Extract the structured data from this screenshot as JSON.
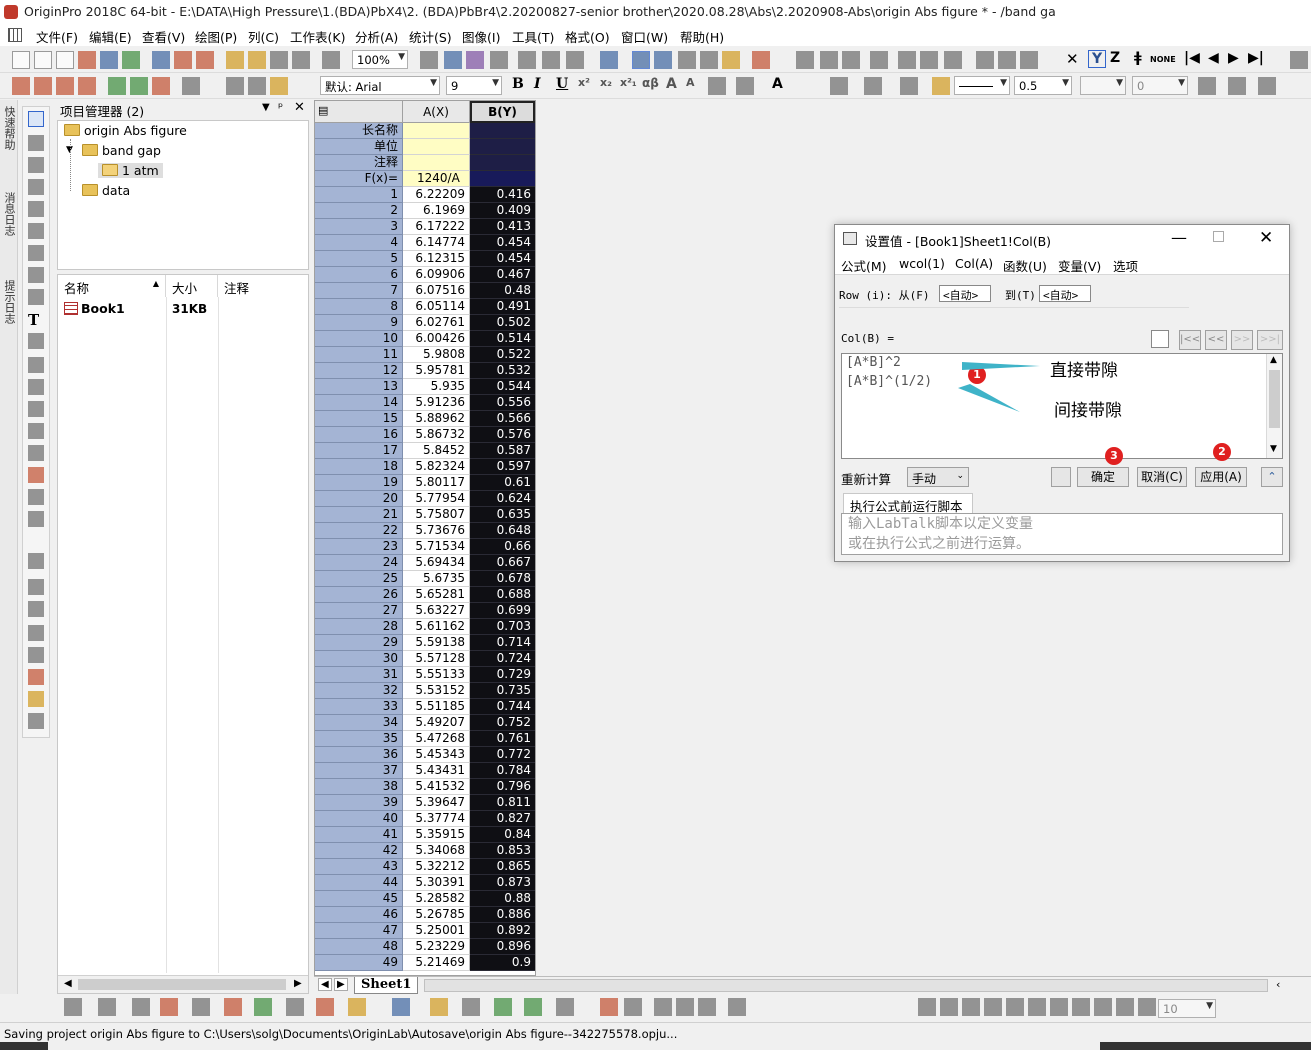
{
  "window": {
    "title": "OriginPro 2018C 64-bit - E:\\DATA\\High Pressure\\1.(BDA)PbX4\\2.  (BDA)PbBr4\\2.20200827-senior brother\\2020.08.28\\Abs\\2.2020908-Abs\\origin Abs figure * - /band ga"
  },
  "menubar": [
    "文件(F)",
    "编辑(E)",
    "查看(V)",
    "绘图(P)",
    "列(C)",
    "工作表(K)",
    "分析(A)",
    "统计(S)",
    "图像(I)",
    "工具(T)",
    "格式(O)",
    "窗口(W)",
    "帮助(H)"
  ],
  "toolbar1": {
    "zoom": "100%"
  },
  "toolbar2": {
    "font_name": "默认: Arial",
    "font_size": "9",
    "bold": "B",
    "italic": "I",
    "underline": "U",
    "line_width": "0.5",
    "value_zero": "0"
  },
  "bottom_toolbar": {
    "size_value": "10"
  },
  "side_tabs": [
    "快速帮助",
    "消息日志",
    "提示日志"
  ],
  "project_manager": {
    "title": "项目管理器 (2)",
    "tree": {
      "root": "origin Abs figure",
      "folder1": "band gap",
      "folder1_child": "1 atm",
      "folder2": "data"
    },
    "list_headers": [
      "名称",
      "大小",
      "注释"
    ],
    "items": [
      {
        "name": "Book1",
        "size": "31KB",
        "comment": ""
      }
    ]
  },
  "worksheet": {
    "columns": [
      "A(X)",
      "B(Y)"
    ],
    "header_rows": [
      "长名称",
      "单位",
      "注释",
      "F(x)="
    ],
    "formula_A": "1240/A",
    "rows": [
      [
        "1",
        "6.22209",
        "0.416"
      ],
      [
        "2",
        "6.1969",
        "0.409"
      ],
      [
        "3",
        "6.17222",
        "0.413"
      ],
      [
        "4",
        "6.14774",
        "0.454"
      ],
      [
        "5",
        "6.12315",
        "0.454"
      ],
      [
        "6",
        "6.09906",
        "0.467"
      ],
      [
        "7",
        "6.07516",
        "0.48"
      ],
      [
        "8",
        "6.05114",
        "0.491"
      ],
      [
        "9",
        "6.02761",
        "0.502"
      ],
      [
        "10",
        "6.00426",
        "0.514"
      ],
      [
        "11",
        "5.9808",
        "0.522"
      ],
      [
        "12",
        "5.95781",
        "0.532"
      ],
      [
        "13",
        "5.935",
        "0.544"
      ],
      [
        "14",
        "5.91236",
        "0.556"
      ],
      [
        "15",
        "5.88962",
        "0.566"
      ],
      [
        "16",
        "5.86732",
        "0.576"
      ],
      [
        "17",
        "5.8452",
        "0.587"
      ],
      [
        "18",
        "5.82324",
        "0.597"
      ],
      [
        "19",
        "5.80117",
        "0.61"
      ],
      [
        "20",
        "5.77954",
        "0.624"
      ],
      [
        "21",
        "5.75807",
        "0.635"
      ],
      [
        "22",
        "5.73676",
        "0.648"
      ],
      [
        "23",
        "5.71534",
        "0.66"
      ],
      [
        "24",
        "5.69434",
        "0.667"
      ],
      [
        "25",
        "5.6735",
        "0.678"
      ],
      [
        "26",
        "5.65281",
        "0.688"
      ],
      [
        "27",
        "5.63227",
        "0.699"
      ],
      [
        "28",
        "5.61162",
        "0.703"
      ],
      [
        "29",
        "5.59138",
        "0.714"
      ],
      [
        "30",
        "5.57128",
        "0.724"
      ],
      [
        "31",
        "5.55133",
        "0.729"
      ],
      [
        "32",
        "5.53152",
        "0.735"
      ],
      [
        "33",
        "5.51185",
        "0.744"
      ],
      [
        "34",
        "5.49207",
        "0.752"
      ],
      [
        "35",
        "5.47268",
        "0.761"
      ],
      [
        "36",
        "5.45343",
        "0.772"
      ],
      [
        "37",
        "5.43431",
        "0.784"
      ],
      [
        "38",
        "5.41532",
        "0.796"
      ],
      [
        "39",
        "5.39647",
        "0.811"
      ],
      [
        "40",
        "5.37774",
        "0.827"
      ],
      [
        "41",
        "5.35915",
        "0.84"
      ],
      [
        "42",
        "5.34068",
        "0.853"
      ],
      [
        "43",
        "5.32212",
        "0.865"
      ],
      [
        "44",
        "5.30391",
        "0.873"
      ],
      [
        "45",
        "5.28582",
        "0.88"
      ],
      [
        "46",
        "5.26785",
        "0.886"
      ],
      [
        "47",
        "5.25001",
        "0.892"
      ],
      [
        "48",
        "5.23229",
        "0.896"
      ],
      [
        "49",
        "5.21469",
        "0.9"
      ]
    ],
    "sheet_tab": "Sheet1"
  },
  "dialog": {
    "title": "设置值 - [Book1]Sheet1!Col(B)",
    "menu": [
      "公式(M)",
      "wcol(1)",
      "Col(A)",
      "函数(U)",
      "变量(V)",
      "选项"
    ],
    "row_label": "Row (i): 从(F)",
    "row_from": "<自动>",
    "row_to_label": "到(T)",
    "row_to": "<自动>",
    "col_label": "Col(B) =",
    "nav": [
      "|<<",
      "<<",
      ">>",
      ">>|"
    ],
    "formula_line1": "[A*B]^2",
    "formula_line2": "[A*B]^(1/2)",
    "annotation1": "直接带隙",
    "annotation2": "间接带隙",
    "badge1": "1",
    "badge2": "2",
    "badge3": "3",
    "recalc_label": "重新计算",
    "recalc_value": "手动",
    "ok": "确定",
    "cancel": "取消(C)",
    "apply": "应用(A)",
    "script_tab": "执行公式前运行脚本",
    "script_placeholder": "输入LabTalk脚本以定义变量\n或在执行公式之前进行运算。",
    "annotation_color": "#3fb3c8",
    "badge_color": "#e02020"
  },
  "status": {
    "text": "Saving project origin Abs figure to C:\\Users\\solg\\Documents\\OriginLab\\Autosave\\origin Abs figure--342275578.opju..."
  }
}
